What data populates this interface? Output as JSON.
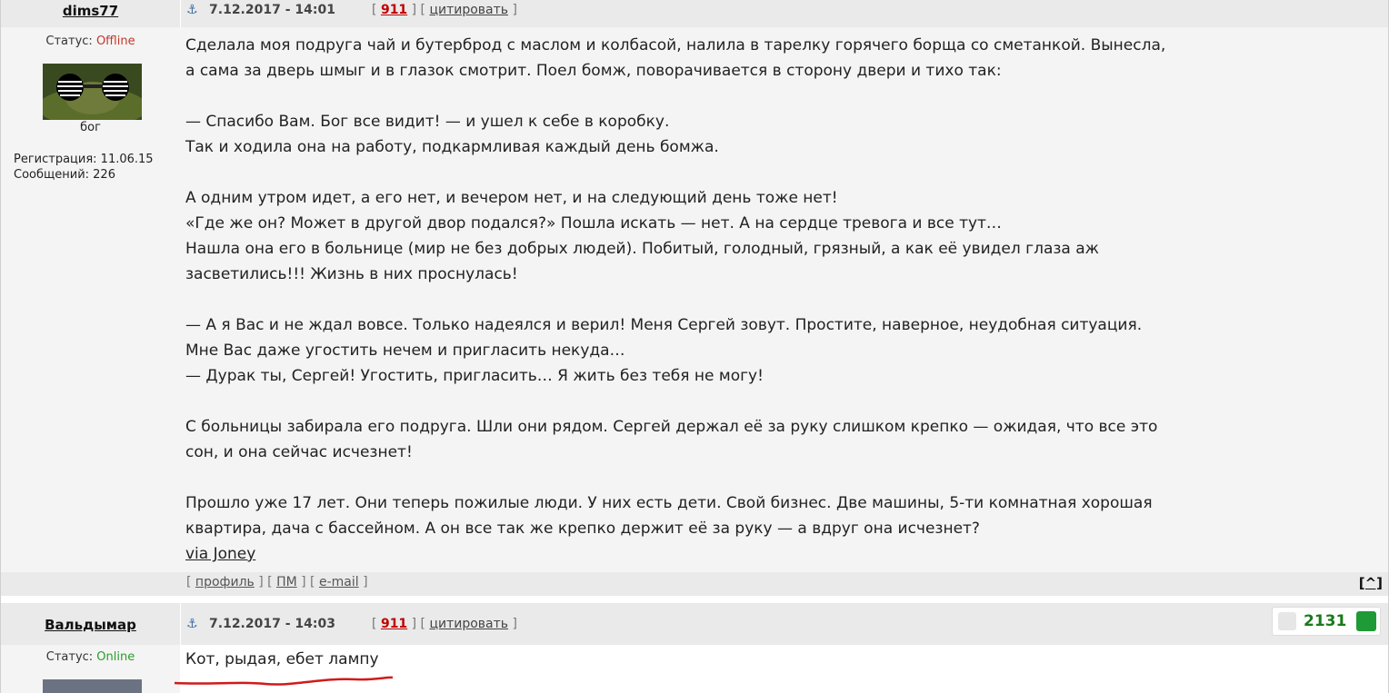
{
  "posts": [
    {
      "username": "dims77",
      "date": "7.12.2017 - 14:01",
      "num": "911",
      "quote": "цитировать",
      "status_label": "Статус: ",
      "status_value": "Offline",
      "rank": "бог",
      "registration": "Регистрация: 11.06.15",
      "messages": "Сообщений: 226",
      "text": "Сделала моя подруга чай и бутерброд с маслом и колбасой, налила в тарелку горячего борща со сметанкой. Вынесла,\nа сама за дверь шмыг и в глазок смотрит. Поел бомж, поворачивается в сторону двери и тихо так:\n\n— Спасибо Вам. Бог все видит! — и ушел к себе в коробку.\nТак и ходила она на работу, подкармливая каждый день бомжа.\n\nА одним утром идет, а его нет, и вечером нет, и на следующий день тоже нет!\n«Где же он? Может в другой двор подался?» Пошла искать — нет. А на сердце тревога и все тут…\nНашла она его в больнице (мир не без добрых людей). Побитый, голодный, грязный, а как её увидел глаза аж\nзасветились!!! Жизнь в них проснулась!\n\n— А я Вас и не ждал вовсе. Только надеялся и верил! Меня Сергей зовут. Простите, наверное, неудобная ситуация.\nМне Вас даже угостить нечем и пригласить некуда…\n— Дурак ты, Сергей! Угостить, пригласить… Я жить без тебя не могу!\n\nС больницы забирала его подруга. Шли они рядом. Сергей держал её за руку слишком крепко — ожидая, что все это\nсон, и она сейчас исчезнет!\n\nПрошло уже 17 лет. Они теперь пожилые люди. У них есть дети. Свой бизнес. Две машины, 5-ти комнатная хорошая\nквартира, дача с бассейном. А он все так же крепко держит её за руку — а вдруг она исчезнет?",
      "via": "via Joney",
      "footer": {
        "profile": "профиль",
        "pm": "ПМ",
        "email": "e-mail",
        "top": "[^]"
      }
    },
    {
      "username": "Вальдымар",
      "date": "7.12.2017 - 14:03",
      "num": "911",
      "quote": "цитировать",
      "status_label": "Статус: ",
      "status_value": "Online",
      "rating": "2131",
      "text": "Кот, рыдая, ебет лампу"
    }
  ],
  "colors": {
    "offline": "#c0392b",
    "online": "#2a9d2a",
    "number_red": "#c00000",
    "rating_green": "#1a7a1a",
    "underline_red": "#d11a1a"
  },
  "icons": [
    "anchor-icon",
    "thumb-down-icon",
    "thumb-up-icon",
    "avatar-icon"
  ]
}
